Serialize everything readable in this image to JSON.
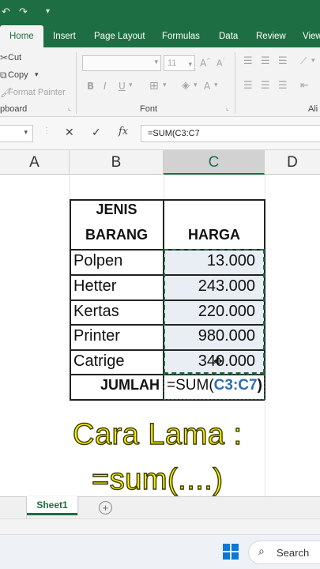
{
  "quick_access": {
    "undo_icon": "undo-icon",
    "redo_icon": "redo-icon",
    "customize_icon": "chevron-down-icon"
  },
  "ribbon_tabs": [
    "Home",
    "Insert",
    "Page Layout",
    "Formulas",
    "Data",
    "Review",
    "View"
  ],
  "active_tab": "Home",
  "clipboard": {
    "cut": "Cut",
    "copy": "Copy",
    "format_painter": "Format Painter",
    "group_label": "pboard"
  },
  "font": {
    "family_value": "",
    "size_value": "11",
    "grow": "A",
    "shrink": "A",
    "bold": "B",
    "italic": "I",
    "underline": "U",
    "font_color": "A",
    "group_label": "Font"
  },
  "alignment": {
    "group_label": "Ali"
  },
  "formula_bar": {
    "name_box": "",
    "cancel": "✕",
    "enter": "✓",
    "fx": "fx",
    "formula": "=SUM(C3:C7"
  },
  "columns": [
    "A",
    "B",
    "C",
    "D"
  ],
  "selected_column": "C",
  "table": {
    "header_col1_line1": "JENIS",
    "header_col1_line2": "BARANG",
    "header_col2": "HARGA",
    "rows": [
      {
        "item": "Polpen",
        "price": "13.000"
      },
      {
        "item": "Hetter",
        "price": "243.000"
      },
      {
        "item": "Kertas",
        "price": "220.000"
      },
      {
        "item": "Printer",
        "price": "980.000"
      },
      {
        "item": "Catrige",
        "price": "340.000"
      }
    ],
    "total_label": "JUMLAH",
    "total_formula_prefix": "=SUM(",
    "total_formula_range": "C3:C7",
    "total_formula_suffix": ")"
  },
  "overlay": {
    "line1": "Cara Lama :",
    "line2": "=sum(....)"
  },
  "sheets": [
    "Sheet1"
  ],
  "active_sheet": "Sheet1",
  "taskbar": {
    "search_label": "Search"
  },
  "colors": {
    "excel_green": "#1e6e43",
    "range_blue": "#2f6db5",
    "overlay_yellow": "#fff200",
    "selection_fill": "#e8eef4"
  }
}
